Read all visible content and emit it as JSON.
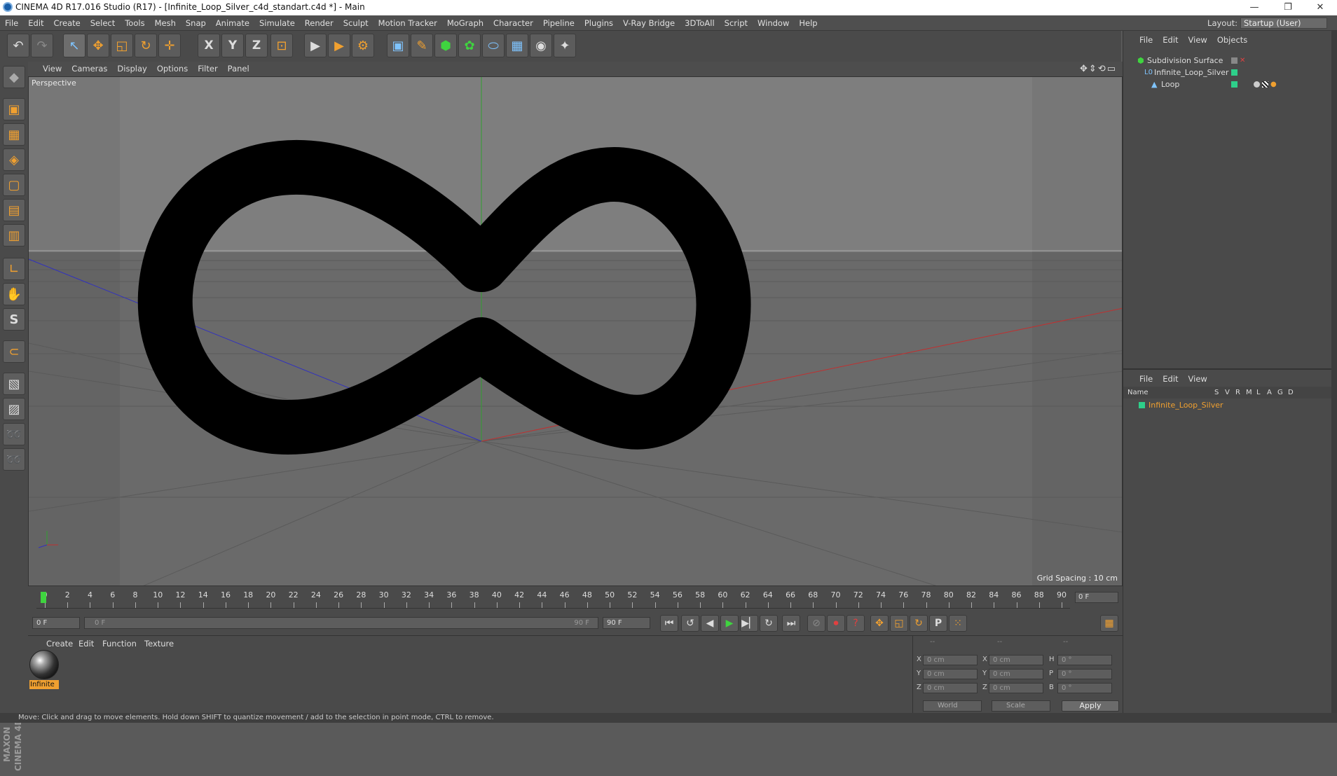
{
  "window": {
    "title": "CINEMA 4D R17.016 Studio (R17) - [Infinite_Loop_Silver_c4d_standart.c4d *] - Main",
    "minimize": "—",
    "restore": "❐",
    "close": "✕"
  },
  "menubar": {
    "items": [
      "File",
      "Edit",
      "Create",
      "Select",
      "Tools",
      "Mesh",
      "Snap",
      "Animate",
      "Simulate",
      "Render",
      "Sculpt",
      "Motion Tracker",
      "MoGraph",
      "Character",
      "Pipeline",
      "Plugins",
      "V-Ray Bridge",
      "3DToAll",
      "Script",
      "Window",
      "Help"
    ],
    "layout_label": "Layout:",
    "layout_value": "Startup (User)"
  },
  "toolbar": {
    "undo": "↶",
    "redo": "↷",
    "select": "↖",
    "move": "✥",
    "scale": "◱",
    "rotate": "↻",
    "transform": "✛",
    "axis_x": "X",
    "axis_y": "Y",
    "axis_z": "Z",
    "coord_system": "⊡",
    "render_view": "▶",
    "render_pic": "▶",
    "render_settings": "⚙",
    "cube": "▣",
    "pen": "✎",
    "subdiv": "⬢",
    "array": "✿",
    "deformer": "⬭",
    "floor": "▦",
    "camera": "◉",
    "light": "✦"
  },
  "left_tools": {
    "icons": [
      "◆",
      "▣",
      "▦",
      "◈",
      "▢",
      "▤",
      "▥",
      "∟",
      "✋",
      "S",
      "⊂",
      "▧",
      "▨",
      "➿",
      "➿"
    ],
    "brand": "MAXON CINEMA 4D"
  },
  "viewport": {
    "menu": [
      "View",
      "Cameras",
      "Display",
      "Options",
      "Filter",
      "Panel"
    ],
    "nav_icons": "✥⇕⟲▭",
    "label": "Perspective",
    "grid_spacing": "Grid Spacing : 10 cm",
    "colors": {
      "background": "#787878",
      "object": "#000000",
      "x_axis": "#c03030",
      "y_axis": "#30a030",
      "z_axis": "#3030c0"
    }
  },
  "timeline": {
    "ticks": [
      "0",
      "2",
      "4",
      "6",
      "8",
      "10",
      "12",
      "14",
      "16",
      "18",
      "20",
      "22",
      "24",
      "26",
      "28",
      "30",
      "32",
      "34",
      "36",
      "38",
      "40",
      "42",
      "44",
      "46",
      "48",
      "50",
      "52",
      "54",
      "56",
      "58",
      "60",
      "62",
      "64",
      "66",
      "68",
      "70",
      "72",
      "74",
      "76",
      "78",
      "80",
      "82",
      "84",
      "86",
      "88",
      "90"
    ],
    "current_frame_display": "0 F"
  },
  "playback": {
    "start_field": "0 F",
    "range_start": "0 F",
    "range_end": "90 F",
    "end_field": "90 F",
    "buttons": [
      "⏮",
      "↺",
      "◀",
      "▶",
      "▶▏",
      "↻",
      "⏭"
    ],
    "key_buttons": [
      "⊘",
      "⏺",
      "?",
      "✥",
      "◱",
      "↻",
      "P",
      "⁙",
      "▦"
    ]
  },
  "material_manager": {
    "menu": [
      "Create",
      "Edit",
      "Function",
      "Texture"
    ],
    "material_name": "Infinite"
  },
  "coordinates": {
    "headers": [
      "--",
      "--",
      "--"
    ],
    "rows": [
      {
        "a": "X",
        "av": "0 cm",
        "b": "X",
        "bv": "0 cm",
        "c": "H",
        "cv": "0 °"
      },
      {
        "a": "Y",
        "av": "0 cm",
        "b": "Y",
        "bv": "0 cm",
        "c": "P",
        "cv": "0 °"
      },
      {
        "a": "Z",
        "av": "0 cm",
        "b": "Z",
        "bv": "0 cm",
        "c": "B",
        "cv": "0 °"
      }
    ],
    "mode_world": "World",
    "mode_scale": "Scale",
    "apply": "Apply"
  },
  "object_manager": {
    "menu": [
      "File",
      "Edit",
      "View",
      "Objects"
    ],
    "objects": [
      {
        "name": "Subdivision Surface",
        "indent": 0
      },
      {
        "name": "Infinite_Loop_Silver",
        "indent": 1
      },
      {
        "name": "Loop",
        "indent": 2
      }
    ]
  },
  "attribute_manager": {
    "menu": [
      "File",
      "Edit",
      "View"
    ],
    "columns": [
      "Name",
      "S",
      "V",
      "R",
      "M",
      "L",
      "A",
      "G",
      "D"
    ],
    "layer_name": "Infinite_Loop_Silver"
  },
  "statusbar": {
    "text": "Move: Click and drag to move elements. Hold down SHIFT to quantize movement / add to the selection in point mode, CTRL to remove."
  }
}
